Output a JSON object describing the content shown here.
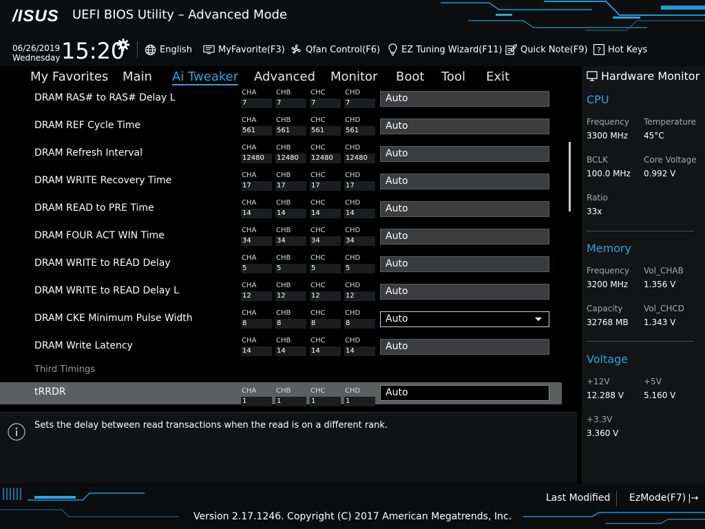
{
  "window": {
    "logo": "/ISUS",
    "title": "UEFI BIOS Utility – Advanced Mode"
  },
  "infobar": {
    "date": "06/26/2019",
    "weekday": "Wednesday",
    "time": "15:20",
    "language": "English",
    "myfavorite": "MyFavorite(F3)",
    "qfan": "Qfan Control(F6)",
    "ez_tuning": "EZ Tuning Wizard(F11)",
    "quick_note": "Quick Note(F9)",
    "hot_keys": "Hot Keys"
  },
  "tabs": [
    "My Favorites",
    "Main",
    "Ai Tweaker",
    "Advanced",
    "Monitor",
    "Boot",
    "Tool",
    "Exit"
  ],
  "active_tab": "Ai Tweaker",
  "channels": [
    "CHA",
    "CHB",
    "CHC",
    "CHD"
  ],
  "rows": [
    {
      "label": "DRAM RAS# to RAS# Delay L",
      "values": [
        "7",
        "7",
        "7",
        "7"
      ],
      "setting": "Auto"
    },
    {
      "label": "DRAM REF Cycle Time",
      "values": [
        "561",
        "561",
        "561",
        "561"
      ],
      "setting": "Auto"
    },
    {
      "label": "DRAM Refresh Interval",
      "values": [
        "12480",
        "12480",
        "12480",
        "12480"
      ],
      "setting": "Auto"
    },
    {
      "label": "DRAM WRITE Recovery Time",
      "values": [
        "17",
        "17",
        "17",
        "17"
      ],
      "setting": "Auto"
    },
    {
      "label": "DRAM READ to PRE Time",
      "values": [
        "14",
        "14",
        "14",
        "14"
      ],
      "setting": "Auto"
    },
    {
      "label": "DRAM FOUR ACT WIN Time",
      "values": [
        "34",
        "34",
        "34",
        "34"
      ],
      "setting": "Auto"
    },
    {
      "label": "DRAM WRITE to READ Delay",
      "values": [
        "5",
        "5",
        "5",
        "5"
      ],
      "setting": "Auto"
    },
    {
      "label": "DRAM WRITE to READ Delay L",
      "values": [
        "12",
        "12",
        "12",
        "12"
      ],
      "setting": "Auto"
    },
    {
      "label": "DRAM CKE Minimum Pulse Width",
      "values": [
        "8",
        "8",
        "8",
        "8"
      ],
      "setting": "Auto"
    },
    {
      "label": "DRAM Write Latency",
      "values": [
        "14",
        "14",
        "14",
        "14"
      ],
      "setting": "Auto"
    }
  ],
  "section_third": "Third Timings",
  "trrdr": {
    "label": "tRRDR",
    "values": [
      "1",
      "1",
      "1",
      "1"
    ],
    "setting": "Auto"
  },
  "help_text": "Sets the delay between read transactions when the read is on a different rank.",
  "hw_monitor": {
    "title": "Hardware Monitor",
    "cpu": {
      "heading": "CPU",
      "frequency_label": "Frequency",
      "frequency": "3300 MHz",
      "temperature_label": "Temperature",
      "temperature": "45°C",
      "bclk_label": "BCLK",
      "bclk": "100.0 MHz",
      "core_voltage_label": "Core Voltage",
      "core_voltage": "0.992 V",
      "ratio_label": "Ratio",
      "ratio": "33x"
    },
    "memory": {
      "heading": "Memory",
      "frequency_label": "Frequency",
      "frequency": "3200 MHz",
      "vol_chab_label": "Vol_CHAB",
      "vol_chab": "1.356 V",
      "capacity_label": "Capacity",
      "capacity": "32768 MB",
      "vol_chcd_label": "Vol_CHCD",
      "vol_chcd": "1.343 V"
    },
    "voltage": {
      "heading": "Voltage",
      "v12_label": "+12V",
      "v12": "12.288 V",
      "v5_label": "+5V",
      "v5": "5.160 V",
      "v33_label": "+3.3V",
      "v33": "3.360 V"
    }
  },
  "bottom": {
    "last_modified": "Last Modified",
    "ezmode": "EzMode(F7)",
    "copyright": "Version 2.17.1246. Copyright (C) 2017 American Megatrends, Inc."
  },
  "colors": {
    "accent": "#2fa4dd",
    "background": "#000000",
    "panel": "#121416",
    "highlight_row": "#5c5e60"
  }
}
